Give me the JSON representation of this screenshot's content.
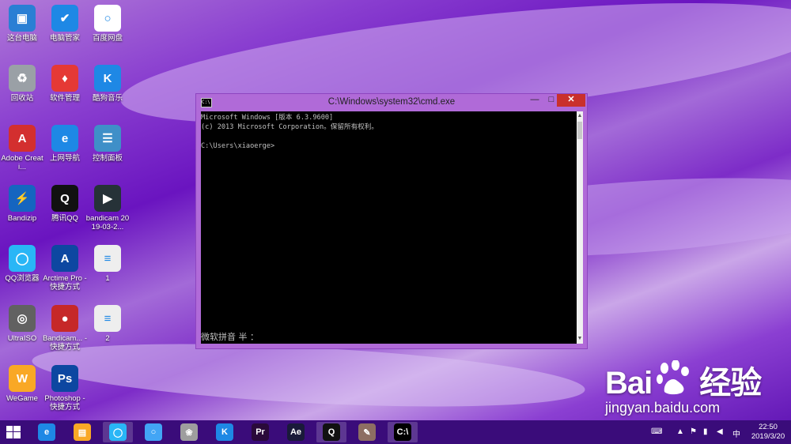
{
  "desktop": {
    "icons": [
      {
        "label": "这台电脑",
        "glyph": "▣",
        "color": "#2a7fd4"
      },
      {
        "label": "电脑管家",
        "glyph": "✔",
        "color": "#1e88e5"
      },
      {
        "label": "百度网盘",
        "glyph": "○",
        "color": "#ffffff"
      },
      {
        "label": "回收站",
        "glyph": "♻",
        "color": "#9aa0a6"
      },
      {
        "label": "软件管理",
        "glyph": "♦",
        "color": "#e53935"
      },
      {
        "label": "酷狗音乐",
        "glyph": "K",
        "color": "#1e88e5"
      },
      {
        "label": "Adobe Creati...",
        "glyph": "A",
        "color": "#d32f2f"
      },
      {
        "label": "上网导航",
        "glyph": "e",
        "color": "#1e88e5"
      },
      {
        "label": "控制面板",
        "glyph": "☰",
        "color": "#3f8fc8"
      },
      {
        "label": "Bandizip",
        "glyph": "⚡",
        "color": "#1565c0"
      },
      {
        "label": "腾讯QQ",
        "glyph": "Q",
        "color": "#111111"
      },
      {
        "label": "bandicam 2019-03-2...",
        "glyph": "▶",
        "color": "#263238"
      },
      {
        "label": "QQ浏览器",
        "glyph": "◯",
        "color": "#29b6f6"
      },
      {
        "label": "Arctime Pro - 快捷方式",
        "glyph": "A",
        "color": "#0d47a1"
      },
      {
        "label": "1",
        "glyph": "≡",
        "color": "#eeeeee"
      },
      {
        "label": "UltraISO",
        "glyph": "◎",
        "color": "#616161"
      },
      {
        "label": "Bandicam... - 快捷方式",
        "glyph": "●",
        "color": "#c62828"
      },
      {
        "label": "2",
        "glyph": "≡",
        "color": "#eeeeee"
      },
      {
        "label": "WeGame",
        "glyph": "W",
        "color": "#f9a825"
      },
      {
        "label": "Photoshop - 快捷方式",
        "glyph": "Ps",
        "color": "#0d47a1"
      }
    ]
  },
  "cmd": {
    "title": "C:\\Windows\\system32\\cmd.exe",
    "lines": [
      "Microsoft Windows [版本 6.3.9600]",
      "(c) 2013 Microsoft Corporation。保留所有权利。",
      "",
      "C:\\Users\\xiaoerge>"
    ],
    "ime": "微软拼音 半 ：",
    "minimize": "—",
    "maximize": "□",
    "close": "✕"
  },
  "watermark": {
    "brand": "Bai\u0000 经验",
    "brand_left": "Bai",
    "brand_right": "经验",
    "url": "jingyan.baidu.com"
  },
  "taskbar": {
    "items": [
      {
        "name": "ie-browser",
        "glyph": "e",
        "color": "#1e88e5",
        "active": false
      },
      {
        "name": "file-explorer",
        "glyph": "▤",
        "color": "#f9a825",
        "active": false
      },
      {
        "name": "qq-browser",
        "glyph": "◯",
        "color": "#29b6f6",
        "active": true
      },
      {
        "name": "baidu-netdisk",
        "glyph": "○",
        "color": "#42a5f5",
        "active": false
      },
      {
        "name": "cat-app",
        "glyph": "❀",
        "color": "#9e9e9e",
        "active": false
      },
      {
        "name": "kugou",
        "glyph": "K",
        "color": "#1e88e5",
        "active": false
      },
      {
        "name": "premiere",
        "glyph": "Pr",
        "color": "#2a0a3a",
        "active": false
      },
      {
        "name": "after-effects",
        "glyph": "Ae",
        "color": "#1a1a3a",
        "active": false
      },
      {
        "name": "qq",
        "glyph": "Q",
        "color": "#111111",
        "active": true
      },
      {
        "name": "paint",
        "glyph": "✎",
        "color": "#8d6e63",
        "active": false
      },
      {
        "name": "cmd",
        "glyph": "C:\\",
        "color": "#000000",
        "active": true
      }
    ],
    "tray": {
      "ime": "中",
      "time": "22:50",
      "date": "2019/3/20"
    }
  }
}
